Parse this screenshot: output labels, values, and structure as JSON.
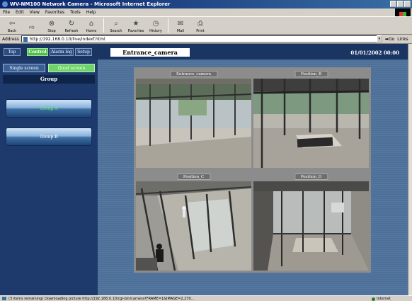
{
  "window": {
    "title": "WV-NM100 Network Camera - Microsoft Internet Explorer"
  },
  "menu": [
    "File",
    "Edit",
    "View",
    "Favorites",
    "Tools",
    "Help"
  ],
  "toolbar": [
    {
      "label": "Back",
      "icon": "back-arrow-icon"
    },
    {
      "label": "",
      "icon": "forward-arrow-icon"
    },
    {
      "label": "Stop",
      "icon": "stop-icon"
    },
    {
      "label": "Refresh",
      "icon": "refresh-icon"
    },
    {
      "label": "Home",
      "icon": "home-icon"
    },
    {
      "label": "Search",
      "icon": "search-icon"
    },
    {
      "label": "Favorites",
      "icon": "favorites-icon"
    },
    {
      "label": "History",
      "icon": "history-icon"
    },
    {
      "label": "Mail",
      "icon": "mail-icon"
    },
    {
      "label": "Print",
      "icon": "print-icon"
    }
  ],
  "address": {
    "label": "Address",
    "url": "http://192.168.0.10/live/indexf.html",
    "go": "Go",
    "links": "Links"
  },
  "nav": {
    "tabs": [
      "Top",
      "Control",
      "Alarm log",
      "Setup"
    ],
    "active_tab": "Control",
    "camera_title": "Entrance_camera",
    "datetime": "01/01/2002  00:00"
  },
  "screens": {
    "single": "Single screen",
    "quad": "Quad screen",
    "active": "Quad screen"
  },
  "group": {
    "header": "Group",
    "buttons": [
      "Group A",
      "Group B"
    ],
    "active": "Group A"
  },
  "cameras": [
    {
      "label": "Entrance_camera"
    },
    {
      "label": "Position_B"
    },
    {
      "label": "Position_C"
    },
    {
      "label": "Position_D"
    }
  ],
  "status": {
    "text": "(3 items remaining) Downloading picture http://192.168.0.10/cgi-bin/camera?FRAME=1&IMAGE=2,270...",
    "zone": "Internet"
  },
  "colors": {
    "nav_bg": "#1b3563",
    "active_green": "#4fbf47",
    "content_bg": "#4d7099"
  }
}
